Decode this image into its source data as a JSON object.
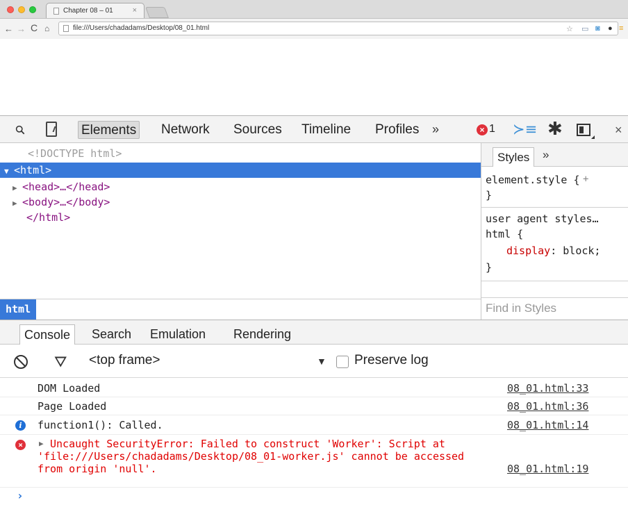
{
  "browser": {
    "tab_title": "Chapter 08 – 01",
    "tab_close": "×",
    "url": "file:///Users/chadadams/Desktop/08_01.html",
    "nav": {
      "back": "←",
      "forward": "→",
      "reload": "C",
      "home": "⌂"
    },
    "star": "☆"
  },
  "devtools": {
    "tabs": [
      "Elements",
      "Network",
      "Sources",
      "Timeline",
      "Profiles"
    ],
    "more": "»",
    "error_count": "1",
    "error_icon": "×",
    "drawer_icon": "≻≡",
    "gear": "✱",
    "close": "×"
  },
  "elements": {
    "doctype": "<!DOCTYPE html>",
    "html_open": "<html>",
    "head": "<head>…</head>",
    "body": "<body>…</body>",
    "html_close": "</html>",
    "breadcrumb": "html"
  },
  "styles": {
    "tab": "Styles",
    "more": "»",
    "element_style": "element.style",
    "brace_open": "{",
    "brace_close": "}",
    "new_rule": "+",
    "ua_label": "user agent styles…",
    "selector": "html {",
    "prop_name": "display",
    "prop_value": ": block;",
    "find_placeholder": "Find in Styles"
  },
  "drawer": {
    "tabs": [
      "Console",
      "Search",
      "Emulation",
      "Rendering"
    ],
    "frame": "<top frame>",
    "frame_arrow": "▼",
    "preserve_log": "Preserve log",
    "filter_icon": "⛛"
  },
  "console": {
    "messages": [
      {
        "text": "DOM Loaded",
        "source": "08_01.html:33"
      },
      {
        "text": "Page Loaded",
        "source": "08_01.html:36"
      },
      {
        "text": "function1(): Called.",
        "source": "08_01.html:14",
        "icon": "i"
      },
      {
        "lines": [
          "Uncaught SecurityError: Failed to construct 'Worker': Script at",
          "'file:///Users/chadadams/Desktop/08_01-worker.js' cannot be accessed",
          "from origin 'null'."
        ],
        "source": "08_01.html:19",
        "icon": "×"
      }
    ],
    "prompt": "›"
  },
  "colors": {
    "selection": "#3879d9",
    "tag": "#881280",
    "error": "#e00000",
    "info": "#1f6fd6"
  }
}
